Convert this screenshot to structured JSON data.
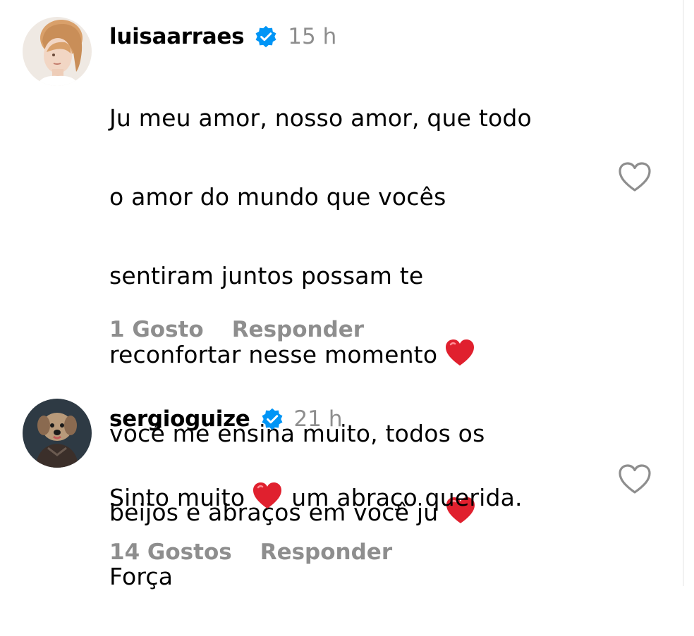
{
  "comments": [
    {
      "username": "luisaarraes",
      "verified": true,
      "time": "15 h",
      "lines": [
        "Ju meu amor, nosso amor, que todo",
        "o amor do mundo que vocês",
        "sentiram juntos possam te",
        "reconfortar nesse momento",
        "você me ensina muito, todos os",
        "beijos e abraços em você ju"
      ],
      "likes_label": "1 Gosto",
      "reply_label": "Responder",
      "avatar_icon": "profile-photo-blonde-woman",
      "like_icon": "heart-outline-icon"
    },
    {
      "username": "sergioguize",
      "verified": true,
      "time": "21 h",
      "lines": [
        "Sinto muito",
        "um abraço querida.",
        "Força"
      ],
      "likes_label": "14 Gostos",
      "reply_label": "Responder",
      "avatar_icon": "profile-photo-dog",
      "like_icon": "heart-outline-icon"
    }
  ],
  "colors": {
    "text": "#000000",
    "muted": "#8e8e8e",
    "verified": "#0095f6",
    "heart_emoji": "#e0202e"
  }
}
